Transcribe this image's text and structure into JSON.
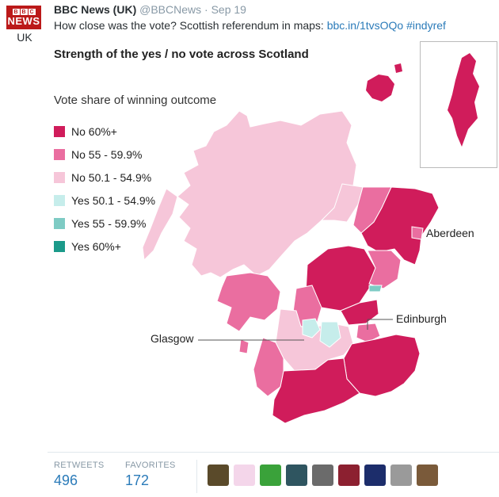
{
  "account": {
    "logo_letters": [
      "B",
      "B",
      "C"
    ],
    "logo_news": "NEWS",
    "logo_region": "UK",
    "name": "BBC News (UK)",
    "handle": "@BBCNews",
    "date_sep": "·",
    "date": "Sep 19"
  },
  "tweet": {
    "text": "How close was the vote? Scottish referendum in maps:",
    "link": "bbc.in/1tvsOQo",
    "hashtag": "#indyref"
  },
  "map": {
    "title": "Strength of the yes / no vote across Scotland",
    "legend_title": "Vote share of winning outcome",
    "legend": [
      {
        "label": "No 60%+",
        "color": "#d01c5b"
      },
      {
        "label": "No 55 - 59.9%",
        "color": "#ea6ea0"
      },
      {
        "label": "No 50.1 - 54.9%",
        "color": "#f6c6d9"
      },
      {
        "label": "Yes 50.1 - 54.9%",
        "color": "#c6edeb"
      },
      {
        "label": "Yes 55 - 59.9%",
        "color": "#7ecbc4"
      },
      {
        "label": "Yes 60%+",
        "color": "#1b9a8a"
      }
    ],
    "cities": {
      "aberdeen": "Aberdeen",
      "edinburgh": "Edinburgh",
      "glasgow": "Glasgow"
    }
  },
  "stats": {
    "retweets_label": "RETWEETS",
    "retweets_value": "496",
    "favorites_label": "FAVORITES",
    "favorites_value": "172"
  },
  "favoriters": [
    {
      "icon": "avatar-photo-1",
      "color": "#5a4a2a"
    },
    {
      "icon": "avatar-script-logo",
      "color": "#f4d6ea"
    },
    {
      "icon": "avatar-green-egg",
      "color": "#3aa23a"
    },
    {
      "icon": "avatar-photo-2",
      "color": "#2f5560"
    },
    {
      "icon": "avatar-photo-3",
      "color": "#6b6b6b"
    },
    {
      "icon": "avatar-photo-4",
      "color": "#8c2030"
    },
    {
      "icon": "avatar-photo-5",
      "color": "#1c2d6b"
    },
    {
      "icon": "avatar-photo-6",
      "color": "#9a9a9a"
    },
    {
      "icon": "avatar-photo-7",
      "color": "#7a5a3a"
    }
  ]
}
